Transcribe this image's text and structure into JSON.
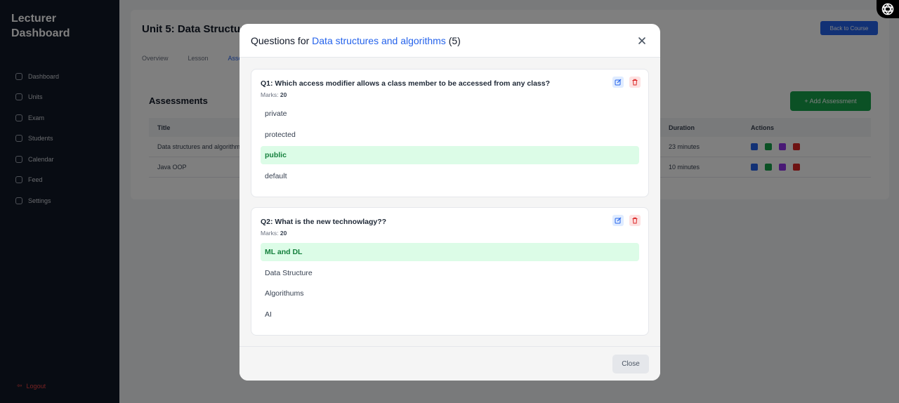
{
  "sidebar": {
    "title": "Lecturer Dashboard",
    "items": [
      {
        "label": "Dashboard",
        "icon": "home-icon"
      },
      {
        "label": "Units",
        "icon": "book-icon"
      },
      {
        "label": "Exam",
        "icon": "document-icon"
      },
      {
        "label": "Students",
        "icon": "users-icon"
      },
      {
        "label": "Calendar",
        "icon": "calendar-icon"
      },
      {
        "label": "Feed",
        "icon": "rss-icon"
      },
      {
        "label": "Settings",
        "icon": "gear-icon"
      }
    ],
    "logout_label": "Logout"
  },
  "page": {
    "unit_title": "Unit 5: Data Structures and Algorithms",
    "back_label": "Back to Course",
    "tabs": [
      "Overview",
      "Lesson",
      "Assessments"
    ],
    "assessments_title": "Assessments",
    "add_label": "+ Add Assessment",
    "table": {
      "headers": {
        "title": "Title",
        "duration": "Duration",
        "actions": "Actions"
      },
      "rows": [
        {
          "title": "Data structures and algorithms",
          "duration": "23 minutes"
        },
        {
          "title": "Java OOP",
          "duration": "10 minutes"
        }
      ]
    }
  },
  "modal": {
    "title_prefix": "Questions for",
    "title_highlight": "Data structures and algorithms",
    "title_count": "(5)",
    "marks_label": "Marks:",
    "questions": [
      {
        "text": "Q1: Which access modifier allows a class member to be accessed from any class?",
        "marks": "20",
        "options": [
          {
            "label": "private",
            "correct": false
          },
          {
            "label": "protected",
            "correct": false
          },
          {
            "label": "public",
            "correct": true
          },
          {
            "label": "default",
            "correct": false
          }
        ]
      },
      {
        "text": "Q2: What is the new technowlagy??",
        "marks": "20",
        "options": [
          {
            "label": "ML and DL",
            "correct": true
          },
          {
            "label": "Data Structure",
            "correct": false
          },
          {
            "label": "Algorithums",
            "correct": false
          },
          {
            "label": "AI",
            "correct": false
          }
        ]
      }
    ],
    "close_label": "Close"
  },
  "colors": {
    "accent": "#2563eb",
    "correct_bg": "#dcfce7",
    "correct_text": "#15803d",
    "danger": "#dc2626"
  }
}
